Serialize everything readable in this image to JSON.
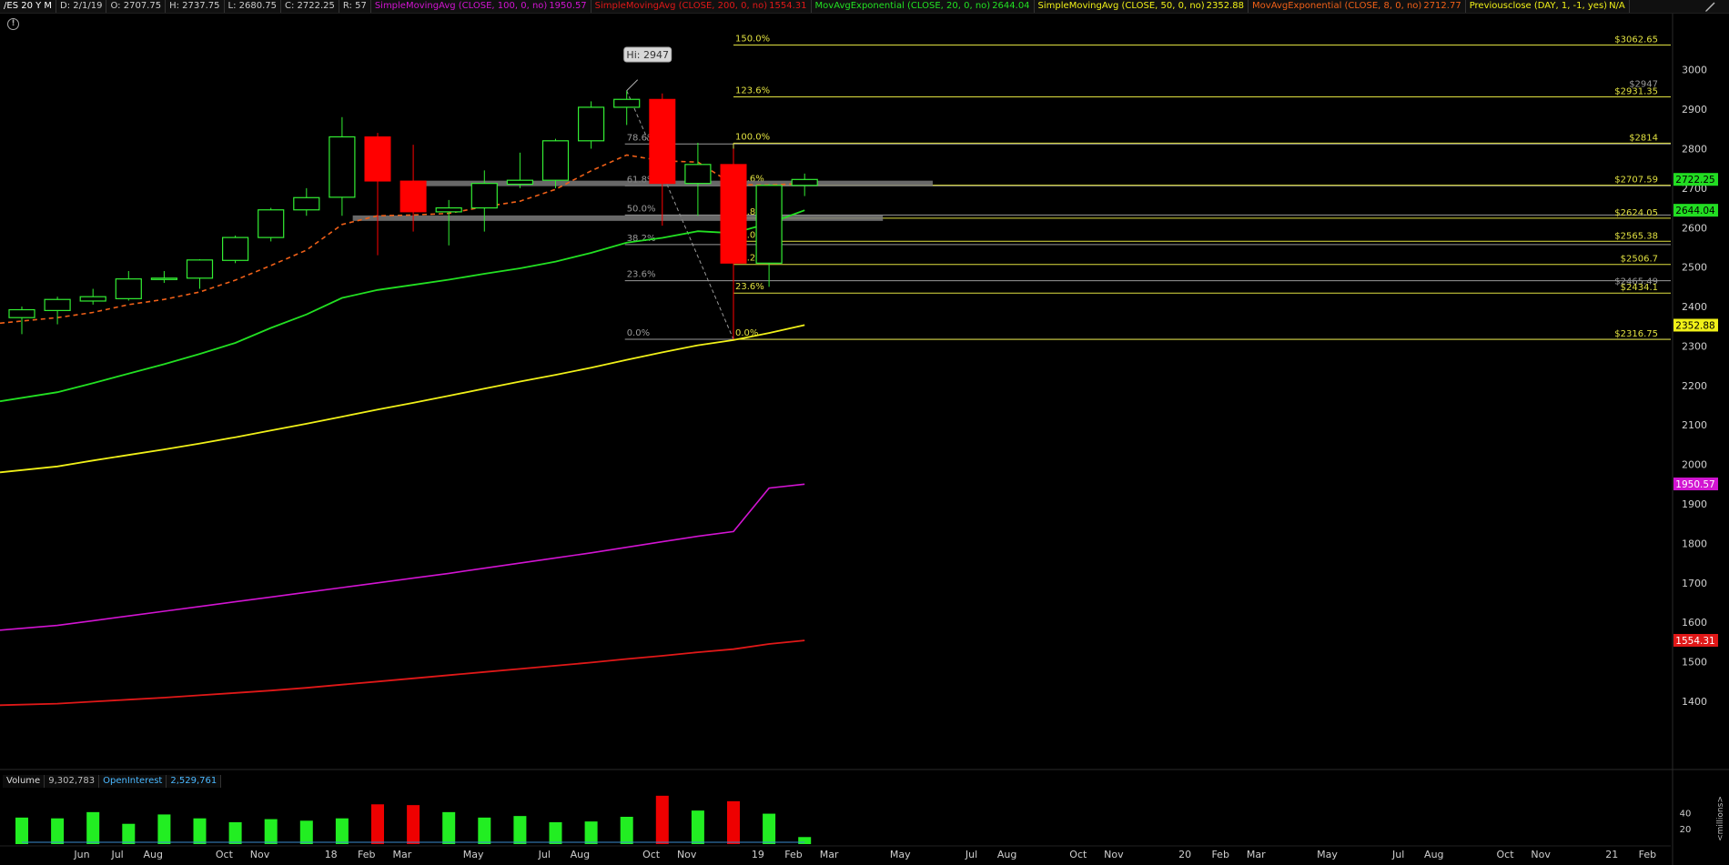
{
  "header": {
    "symbol": "/ES 20 Y M",
    "date": "D: 2/1/19",
    "open": "O: 2707.75",
    "high": "H: 2737.75",
    "low": "L: 2680.75",
    "close": "C: 2722.25",
    "range": "R: 57",
    "studies": [
      {
        "label": "SimpleMovingAvg (CLOSE, 100, 0, no)",
        "value": "1950.57",
        "color": "#d214d2"
      },
      {
        "label": "SimpleMovingAvg (CLOSE, 200, 0, no)",
        "value": "1554.31",
        "color": "#e01818"
      },
      {
        "label": "MovAvgExponential (CLOSE, 20, 0, no)",
        "value": "2644.04",
        "color": "#22e022"
      },
      {
        "label": "SimpleMovingAvg (CLOSE, 50, 0, no)",
        "value": "2352.88",
        "color": "#f0f018"
      },
      {
        "label": "MovAvgExponential (CLOSE, 8, 0, no)",
        "value": "2712.77",
        "color": "#f06018"
      },
      {
        "label": "Previousclose (DAY, 1, -1, yes)",
        "value": "N/A",
        "color": "#f0f018"
      }
    ]
  },
  "volume_header": {
    "volume_label": "Volume",
    "volume_value": "9,302,783",
    "oi_label": "OpenInterest",
    "oi_value": "2,529,761"
  },
  "icons": {
    "info": "info-icon",
    "drawing_tool": "pencil-icon"
  },
  "colors": {
    "up": "#33ee33",
    "down": "#ff0000",
    "fib_yellow": "#e0e040",
    "fib_gray": "#9a9a9a",
    "support_gray": "#7a7a7a",
    "ema8": "#f06018",
    "ema20": "#22e022",
    "sma50": "#f0f018",
    "sma100": "#d214d2",
    "sma200": "#e01818",
    "vol_up": "#22ee22",
    "vol_down": "#ee0000"
  },
  "chart_data": {
    "type": "candlestick",
    "y_axis": {
      "ticks": [
        1400,
        1500,
        1600,
        1700,
        1800,
        1900,
        2000,
        2100,
        2200,
        2300,
        2400,
        2500,
        2600,
        2700,
        2800,
        2900,
        3000
      ],
      "range": [
        1310,
        3050
      ]
    },
    "x_axis_labels": [
      "Jun",
      "Jul",
      "Aug",
      "Oct",
      "Nov",
      "18",
      "Feb",
      "Mar",
      "May",
      "Jul",
      "Aug",
      "Oct",
      "Nov",
      "19",
      "Feb",
      "Mar",
      "May",
      "Jul",
      "Aug",
      "Oct",
      "Nov",
      "20",
      "Feb",
      "Mar",
      "May",
      "Jul",
      "Aug",
      "Oct",
      "Nov",
      "21",
      "Feb"
    ],
    "x_axis_positions": [
      0,
      1,
      2,
      4,
      5,
      7,
      8,
      9,
      11,
      13,
      14,
      16,
      17,
      19,
      20,
      21,
      23,
      25,
      26,
      28,
      29,
      31,
      32,
      33,
      35,
      37,
      38,
      40,
      41,
      43,
      44
    ],
    "candles": [
      {
        "o": 2372,
        "h": 2400,
        "l": 2330,
        "c": 2392
      },
      {
        "o": 2390,
        "h": 2425,
        "l": 2355,
        "c": 2418
      },
      {
        "o": 2414,
        "h": 2445,
        "l": 2405,
        "c": 2425
      },
      {
        "o": 2420,
        "h": 2490,
        "l": 2415,
        "c": 2470
      },
      {
        "o": 2470,
        "h": 2490,
        "l": 2460,
        "c": 2472
      },
      {
        "o": 2472,
        "h": 2520,
        "l": 2445,
        "c": 2518
      },
      {
        "o": 2517,
        "h": 2580,
        "l": 2510,
        "c": 2575
      },
      {
        "o": 2575,
        "h": 2650,
        "l": 2565,
        "c": 2645
      },
      {
        "o": 2645,
        "h": 2700,
        "l": 2630,
        "c": 2676
      },
      {
        "o": 2677,
        "h": 2880,
        "l": 2630,
        "c": 2830
      },
      {
        "o": 2830,
        "h": 2840,
        "l": 2530,
        "c": 2718
      },
      {
        "o": 2718,
        "h": 2810,
        "l": 2590,
        "c": 2640
      },
      {
        "o": 2640,
        "h": 2670,
        "l": 2555,
        "c": 2650
      },
      {
        "o": 2650,
        "h": 2745,
        "l": 2590,
        "c": 2712
      },
      {
        "o": 2710,
        "h": 2790,
        "l": 2700,
        "c": 2720
      },
      {
        "o": 2720,
        "h": 2825,
        "l": 2700,
        "c": 2820
      },
      {
        "o": 2820,
        "h": 2920,
        "l": 2800,
        "c": 2905
      },
      {
        "o": 2905,
        "h": 2947,
        "l": 2860,
        "c": 2925
      },
      {
        "o": 2925,
        "h": 2940,
        "l": 2605,
        "c": 2712
      },
      {
        "o": 2712,
        "h": 2815,
        "l": 2630,
        "c": 2760
      },
      {
        "o": 2760,
        "h": 2800,
        "l": 2317,
        "c": 2510
      },
      {
        "o": 2510,
        "h": 2710,
        "l": 2450,
        "c": 2707
      },
      {
        "o": 2707,
        "h": 2737,
        "l": 2680,
        "c": 2722
      }
    ],
    "series": [
      {
        "id": "ema8",
        "values": [
          2358,
          2372,
          2385,
          2405,
          2418,
          2437,
          2467,
          2504,
          2543,
          2608,
          2630,
          2632,
          2636,
          2653,
          2667,
          2697,
          2744,
          2784,
          2769,
          2766,
          2709,
          2708,
          2712
        ]
      },
      {
        "id": "ema20",
        "values": [
          2160,
          2183,
          2206,
          2230,
          2254,
          2280,
          2308,
          2346,
          2380,
          2422,
          2442,
          2455,
          2468,
          2483,
          2497,
          2514,
          2536,
          2562,
          2574,
          2591,
          2586,
          2611,
          2644
        ]
      },
      {
        "id": "sma50",
        "values": [
          1980,
          1995,
          2010,
          2024,
          2038,
          2053,
          2069,
          2086,
          2103,
          2121,
          2139,
          2156,
          2174,
          2192,
          2210,
          2227,
          2245,
          2265,
          2284,
          2302,
          2315,
          2333,
          2353
        ]
      },
      {
        "id": "sma100",
        "values": [
          1580,
          1592,
          1604,
          1616,
          1628,
          1640,
          1652,
          1664,
          1676,
          1688,
          1700,
          1712,
          1724,
          1737,
          1750,
          1763,
          1776,
          1790,
          1804,
          1818,
          1830,
          1940,
          1950
        ]
      },
      {
        "id": "sma200",
        "values": [
          1390,
          1394,
          1399,
          1404,
          1409,
          1415,
          1421,
          1427,
          1434,
          1442,
          1450,
          1458,
          1466,
          1474,
          1482,
          1490,
          1498,
          1507,
          1515,
          1524,
          1532,
          1545,
          1554
        ]
      }
    ],
    "volume": {
      "axis_ticks": [
        20,
        40
      ],
      "axis_unit": "<millions>",
      "values": [
        34,
        33,
        41,
        26,
        38,
        33,
        28,
        32,
        30,
        33,
        51,
        50,
        41,
        34,
        36,
        28,
        29,
        35,
        62,
        43,
        55,
        39,
        9
      ],
      "direction": [
        "up",
        "up",
        "up",
        "up",
        "up",
        "up",
        "up",
        "up",
        "up",
        "up",
        "down",
        "down",
        "up",
        "up",
        "up",
        "up",
        "up",
        "up",
        "down",
        "up",
        "down",
        "up",
        "up"
      ]
    },
    "fib_big": {
      "from": 2317,
      "to": 2947,
      "start_index": 17,
      "levels": [
        {
          "label": "0.0%",
          "price": 2317
        },
        {
          "label": "23.6%",
          "price": 2465.49
        },
        {
          "label": "38.2%",
          "price": 2557
        },
        {
          "label": "50.0%",
          "price": 2632
        },
        {
          "label": "61.8%",
          "price": 2706
        },
        {
          "label": "78.6%",
          "price": 2812
        }
      ],
      "right_labels": [
        "$2465.49",
        "$2947"
      ]
    },
    "fib_small": {
      "start_index": 20,
      "levels": [
        {
          "label": "0.0%",
          "price": 2316.75
        },
        {
          "label": "23.6%",
          "price": 2434.1
        },
        {
          "label": "38.2%",
          "price": 2506.7
        },
        {
          "label": "50.0%",
          "price": 2565.38
        },
        {
          "label": "61.8%",
          "price": 2624.05
        },
        {
          "label": "78.6%",
          "price": 2707.59
        },
        {
          "label": "100.0%",
          "price": 2814
        },
        {
          "label": "123.6%",
          "price": 2931.35
        },
        {
          "label": "150.0%",
          "price": 3062.65
        }
      ],
      "right_labels": [
        "$2316.75",
        "$2434.1",
        "$2506.7",
        "$2565.38",
        "$2624.05",
        "$2707.59",
        "$2814",
        "$2931.35",
        "$3062.65"
      ]
    },
    "support_zones": [
      {
        "price": 2712,
        "from_index": 11,
        "to_index": 25.6
      },
      {
        "price": 2624,
        "from_index": 9.3,
        "to_index": 24.2
      }
    ],
    "hi_bubble": "Hi: 2947",
    "hi_price": 2947,
    "hi_index": 17,
    "price_tags": [
      {
        "text": "2722.25",
        "price": 2722.25,
        "bg": "#22dd22",
        "fg": "#000"
      },
      {
        "text": "2644.04",
        "price": 2644.04,
        "bg": "#22dd22",
        "fg": "#000"
      },
      {
        "text": "2352.88",
        "price": 2352.88,
        "bg": "#f0f018",
        "fg": "#000"
      },
      {
        "text": "1950.57",
        "price": 1950.57,
        "bg": "#d214d2",
        "fg": "#fff"
      },
      {
        "text": "1554.31",
        "price": 1554.31,
        "bg": "#e01818",
        "fg": "#fff"
      }
    ]
  }
}
